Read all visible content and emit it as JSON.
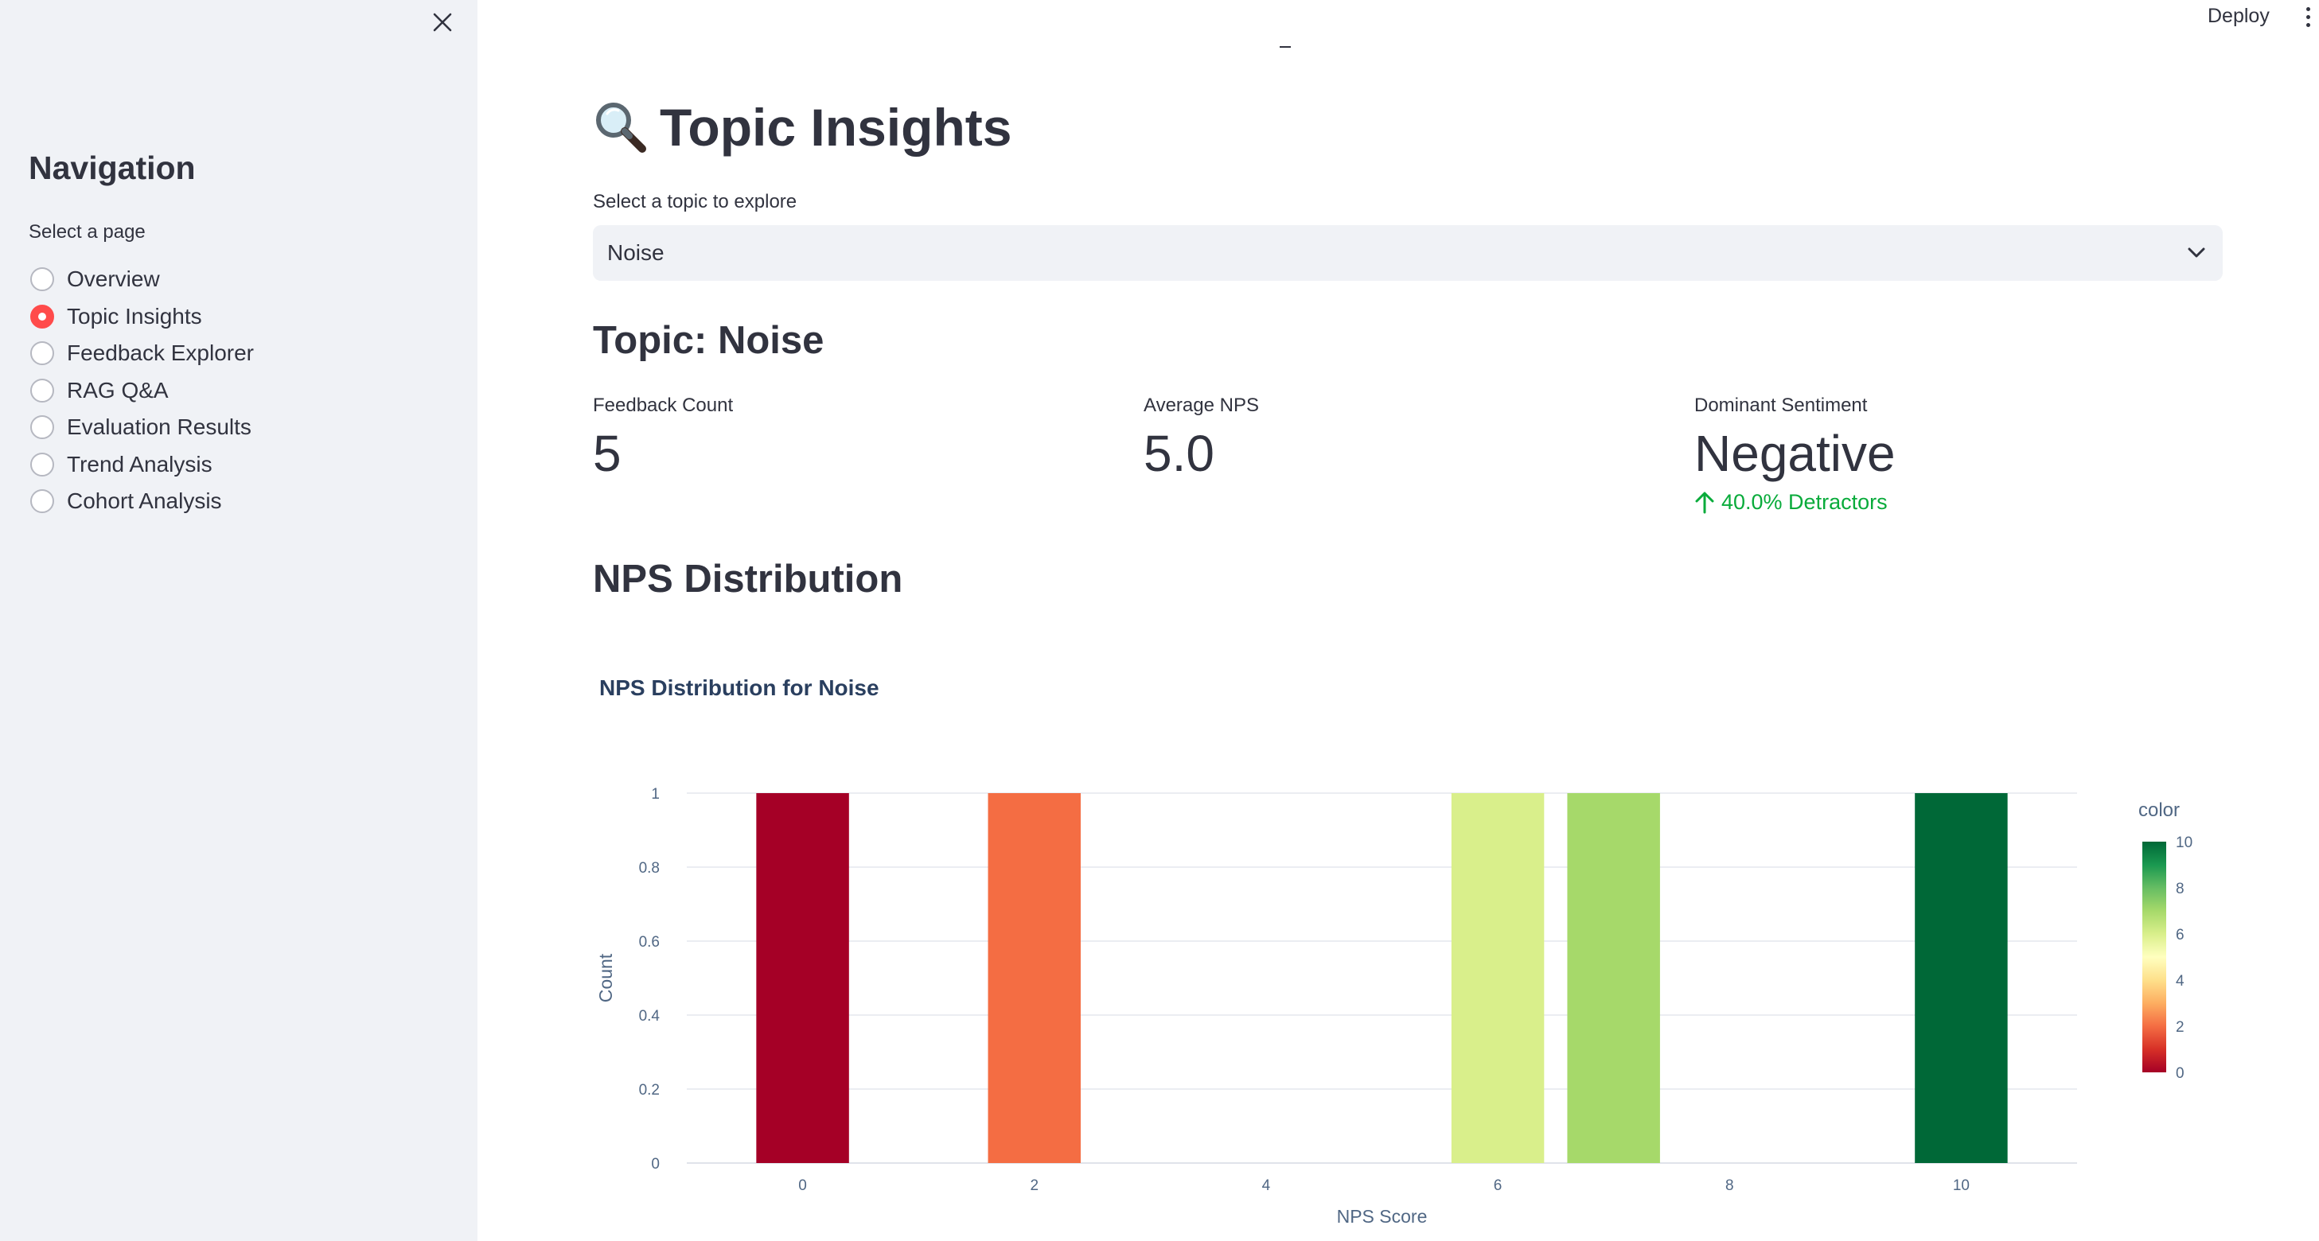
{
  "sidebar": {
    "close_icon": "close-icon",
    "title": "Navigation",
    "select_label": "Select a page",
    "items": [
      {
        "label": "Overview",
        "selected": false
      },
      {
        "label": "Topic Insights",
        "selected": true
      },
      {
        "label": "Feedback Explorer",
        "selected": false
      },
      {
        "label": "RAG Q&A",
        "selected": false
      },
      {
        "label": "Evaluation Results",
        "selected": false
      },
      {
        "label": "Trend Analysis",
        "selected": false
      },
      {
        "label": "Cohort Analysis",
        "selected": false
      }
    ]
  },
  "topbar": {
    "deploy_label": "Deploy",
    "menu_icon": "more-vertical-icon"
  },
  "main": {
    "title_icon": "magnifying-glass-icon",
    "title": "Topic Insights",
    "select_label": "Select a topic to explore",
    "selected_topic": "Noise",
    "topic_heading": "Topic: Noise",
    "metrics": [
      {
        "label": "Feedback Count",
        "value": "5"
      },
      {
        "label": "Average NPS",
        "value": "5.0"
      },
      {
        "label": "Dominant Sentiment",
        "value": "Negative",
        "delta": "40.0% Detractors",
        "delta_direction": "up",
        "delta_color": "#09ab3b"
      }
    ],
    "section_heading": "NPS Distribution"
  },
  "chart_data": {
    "type": "bar",
    "title": "NPS Distribution for Noise",
    "xlabel": "NPS Score",
    "ylabel": "Count",
    "x": [
      0,
      2,
      6,
      7,
      10
    ],
    "values": [
      1,
      1,
      1,
      1,
      1
    ],
    "xlim": [
      -1,
      11
    ],
    "ylim": [
      0,
      1
    ],
    "xticks": [
      0,
      2,
      4,
      6,
      8,
      10
    ],
    "yticks": [
      0,
      0.2,
      0.4,
      0.6,
      0.8,
      1
    ],
    "ytick_labels": [
      "0",
      "0.2",
      "0.4",
      "0.6",
      "0.8",
      "1"
    ],
    "grid": true,
    "colorbar": {
      "title": "color",
      "range": [
        0,
        10
      ],
      "ticks": [
        0,
        2,
        4,
        6,
        8,
        10
      ],
      "colorscale": [
        "#a50026",
        "#d73027",
        "#f46d43",
        "#fdae61",
        "#fee08b",
        "#ffffbf",
        "#d9ef8b",
        "#a6d96a",
        "#66bd63",
        "#1a9850",
        "#006837"
      ]
    }
  }
}
